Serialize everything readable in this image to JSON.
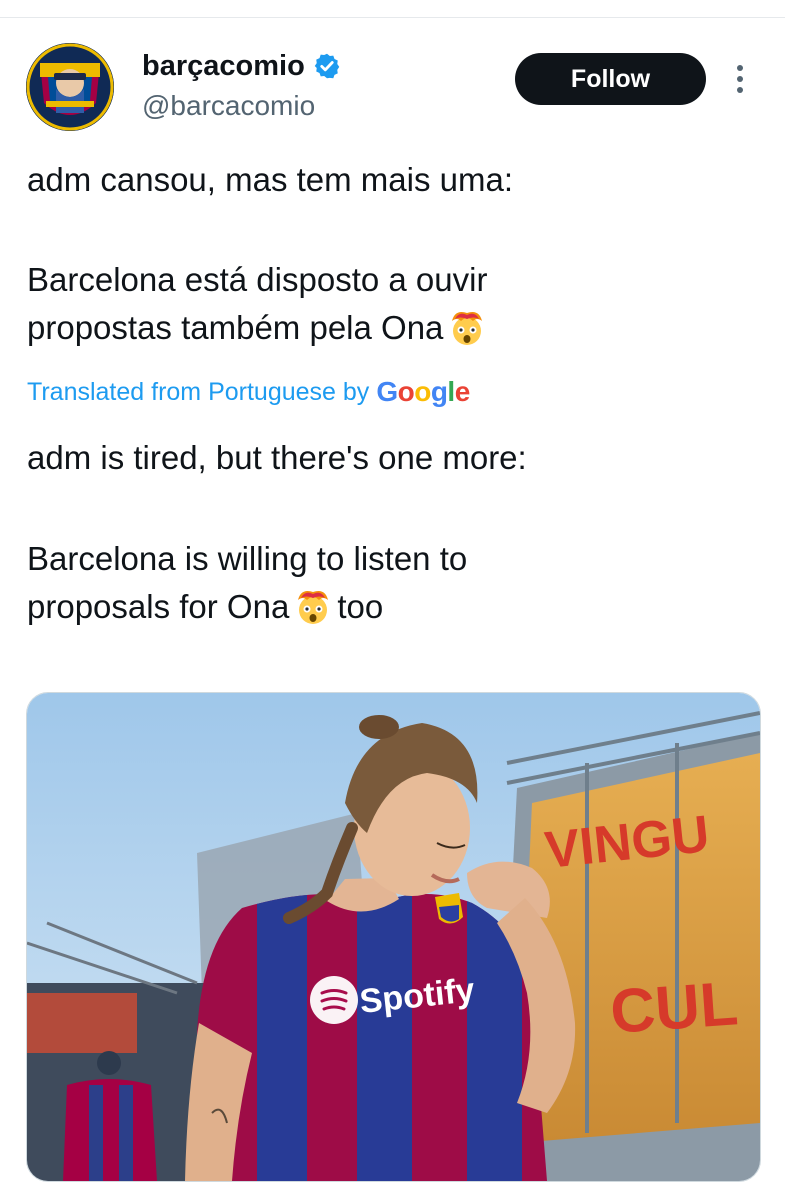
{
  "author": {
    "display_name": "barçacomio",
    "handle": "@barcacomio",
    "verified": true,
    "avatar_icon": "profile-avatar",
    "verified_icon": "verified-badge-icon"
  },
  "actions": {
    "follow_label": "Follow",
    "more_icon": "more-vertical-icon"
  },
  "tweet": {
    "original_line1": "adm cansou, mas tem mais uma:",
    "original_line2_part1": "Barcelona está disposto a ouvir",
    "original_line2_part2": "propostas também pela Ona",
    "original_emoji": "exploding-head-emoji",
    "translation_label": "Translated from Portuguese by",
    "translation_provider": {
      "letters": [
        "G",
        "o",
        "o",
        "g",
        "l",
        "e"
      ]
    },
    "translated_line1": "adm is tired, but there's one more:",
    "translated_line2_part1": "Barcelona is willing to listen to",
    "translated_line2_part2": "proposals for Ona",
    "translated_line2_part3": "too",
    "translated_emoji": "exploding-head-emoji"
  },
  "media": {
    "image": "photo-player-kissing-jersey-crest",
    "jersey_sponsor": "Spotify",
    "background_sign_top": "VINGU",
    "background_sign_bottom": "CUL"
  },
  "colors": {
    "text_primary": "#0f1419",
    "text_secondary": "#536471",
    "link": "#1d9bf0",
    "follow_bg": "#0f1419",
    "follow_text": "#ffffff",
    "border": "#cfd9de"
  }
}
